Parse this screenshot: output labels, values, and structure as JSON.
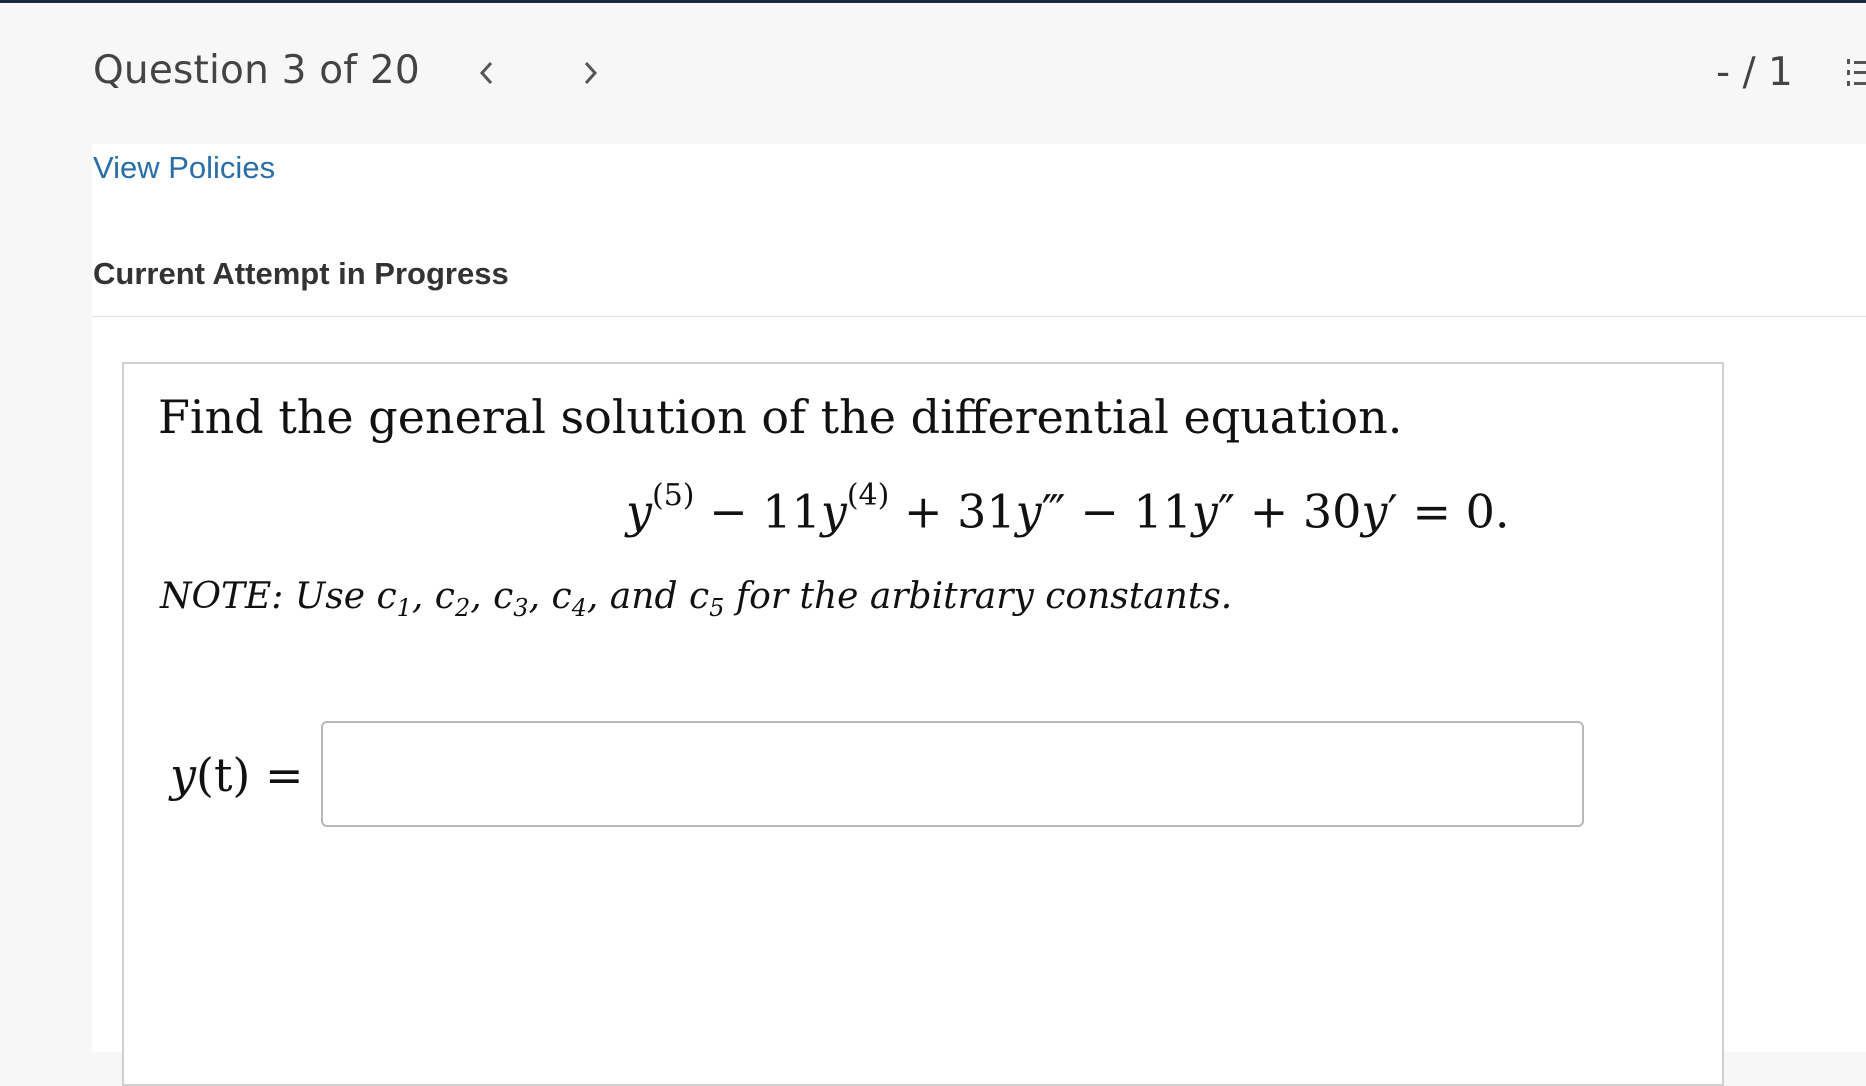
{
  "header": {
    "question_label": "Question 3 of 20",
    "score": "- / 1",
    "icons": {
      "prev": "chevron-left-icon",
      "next": "chevron-right-icon",
      "list": "numbered-list-icon"
    }
  },
  "links": {
    "view_policies": "View Policies"
  },
  "status": {
    "attempt": "Current Attempt in Progress"
  },
  "question": {
    "prompt": "Find the general solution of the differential equation.",
    "equation": {
      "t1_var": "y",
      "t1_sup": "(5)",
      "t2_text": " − 11",
      "t2_var": "y",
      "t2_sup": "(4)",
      "t3_text": " + 31",
      "t3_var": "y",
      "t3_prime": "‴",
      "t4_text": " − 11",
      "t4_var": "y",
      "t4_prime": "″",
      "t5_text": " + 30",
      "t5_var": "y",
      "t5_prime": "′",
      "rhs": " = 0."
    },
    "note": {
      "prefix": "NOTE: Use c",
      "s1": "1",
      "t1": ", c",
      "s2": "2",
      "t2": ", c",
      "s3": "3",
      "t3": ", c",
      "s4": "4",
      "t4": ", and c",
      "s5": "5",
      "t5": " for the arbitrary constants."
    },
    "answer_label": {
      "var": "y",
      "rest": "(t) ="
    },
    "answer_value": ""
  },
  "colors": {
    "link": "#2a6ea8",
    "topline": "#1b2a3c",
    "header_bg": "#f7f7f7"
  }
}
